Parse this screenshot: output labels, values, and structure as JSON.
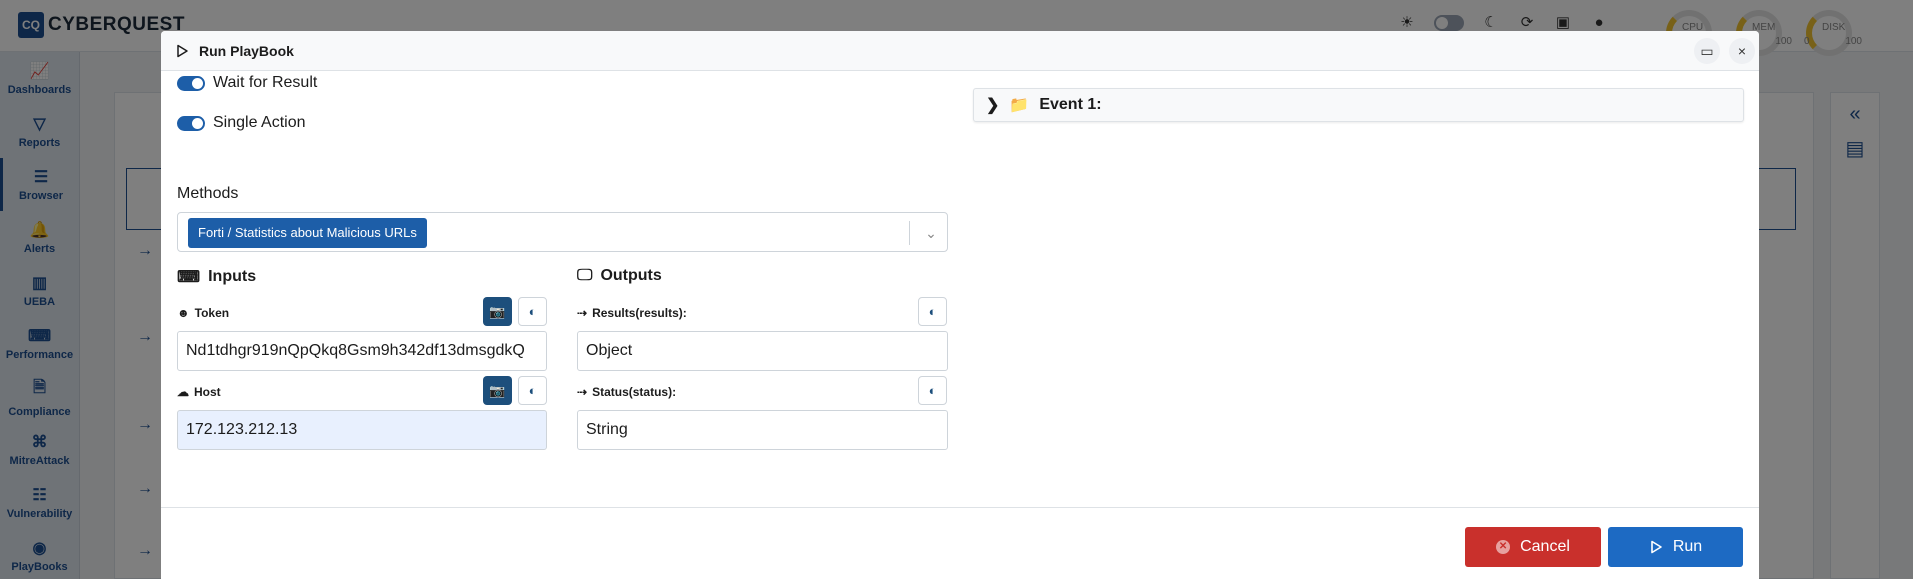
{
  "app": {
    "logo_mark": "CQ",
    "logo_text": "CYBERQUEST"
  },
  "topbar": {
    "icons": [
      "sun-icon",
      "theme-toggle",
      "moon-icon",
      "refresh-icon",
      "dashboard-icon",
      "user-icon"
    ],
    "gauges": [
      {
        "label": "CPU",
        "min": "",
        "max": ""
      },
      {
        "label": "MEM",
        "min": "0",
        "max": "100"
      },
      {
        "label": "DISK",
        "min": "0",
        "max": "100"
      }
    ]
  },
  "sidebar": {
    "items": [
      {
        "label": "Dashboards",
        "icon": "chart-icon"
      },
      {
        "label": "Reports",
        "icon": "filter-icon"
      },
      {
        "label": "Browser",
        "icon": "list-icon",
        "active": true
      },
      {
        "label": "Alerts",
        "icon": "bell-icon"
      },
      {
        "label": "UEBA",
        "icon": "bar-chart-icon"
      },
      {
        "label": "Performance",
        "icon": "keyboard-icon"
      },
      {
        "label": "Compliance",
        "icon": "document-icon"
      },
      {
        "label": "MitreAttack",
        "icon": "command-icon"
      },
      {
        "label": "Vulnerability",
        "icon": "server-icon"
      },
      {
        "label": "PlayBooks",
        "icon": "playbook-icon"
      }
    ]
  },
  "modal": {
    "title": "Run PlayBook",
    "toggles": [
      {
        "label": "Wait for Result",
        "on": true
      },
      {
        "label": "Single Action",
        "on": true
      }
    ],
    "methods": {
      "label": "Methods",
      "selected": "Forti / Statistics about Malicious URLs"
    },
    "inputs": {
      "title": "Inputs",
      "fields": [
        {
          "label": "Token",
          "value": "Nd1tdhgr919nQpQkq8Gsm9h342df13dmsgdkQ"
        },
        {
          "label": "Host",
          "value": "172.123.212.13"
        }
      ]
    },
    "outputs": {
      "title": "Outputs",
      "fields": [
        {
          "label": "Results(results):",
          "value": "Object"
        },
        {
          "label": "Status(status):",
          "value": "String"
        }
      ]
    },
    "event": {
      "label": "Event 1:"
    },
    "footer": {
      "cancel_label": "Cancel",
      "run_label": "Run"
    }
  },
  "colors": {
    "primary": "#1d6ac3",
    "danger": "#c9302c",
    "brand": "#1d4f91"
  }
}
